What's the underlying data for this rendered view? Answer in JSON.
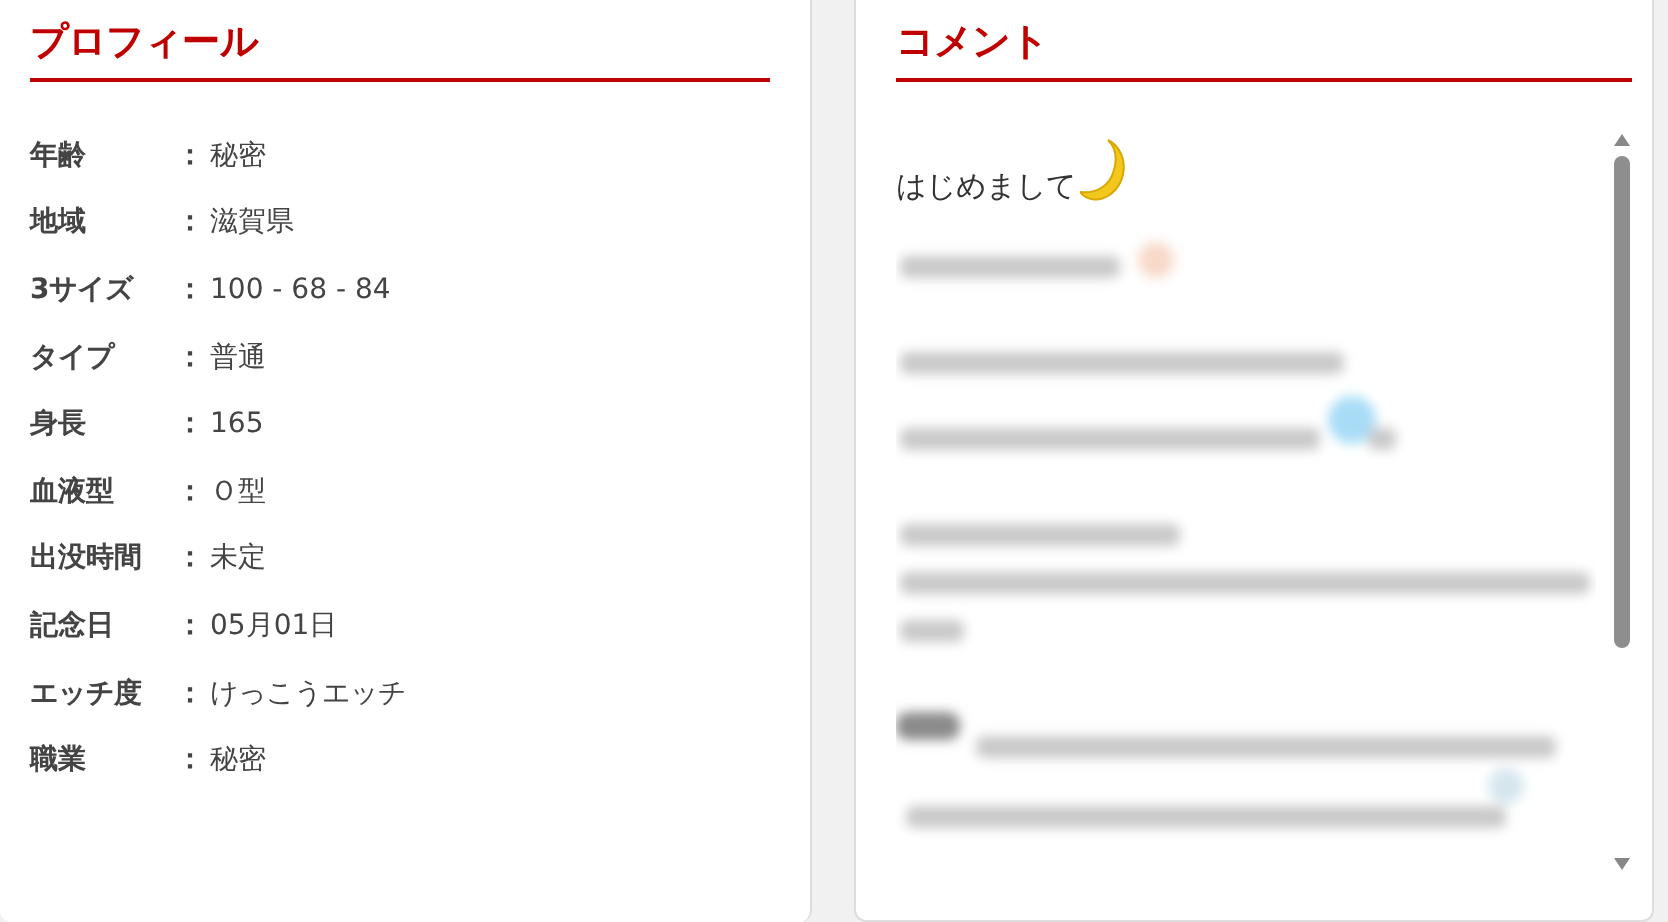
{
  "profile": {
    "title": "プロフィール",
    "rows": [
      {
        "label": "年齢",
        "separator": "：",
        "value": "秘密"
      },
      {
        "label": "地域",
        "separator": "：",
        "value": "滋賀県"
      },
      {
        "label": "3サイズ",
        "separator": "：",
        "value": "100 - 68 - 84"
      },
      {
        "label": "タイプ",
        "separator": "：",
        "value": "普通"
      },
      {
        "label": "身長",
        "separator": "：",
        "value": "165"
      },
      {
        "label": "血液型",
        "separator": "：",
        "value": "Ｏ型"
      },
      {
        "label": "出没時間",
        "separator": "：",
        "value": "未定"
      },
      {
        "label": "記念日",
        "separator": "：",
        "value": "05月01日"
      },
      {
        "label": "エッチ度",
        "separator": "：",
        "value": "けっこうエッチ"
      },
      {
        "label": "職業",
        "separator": "：",
        "value": "秘密"
      }
    ]
  },
  "comment": {
    "title": "コメント",
    "greeting": "はじめまして"
  }
}
